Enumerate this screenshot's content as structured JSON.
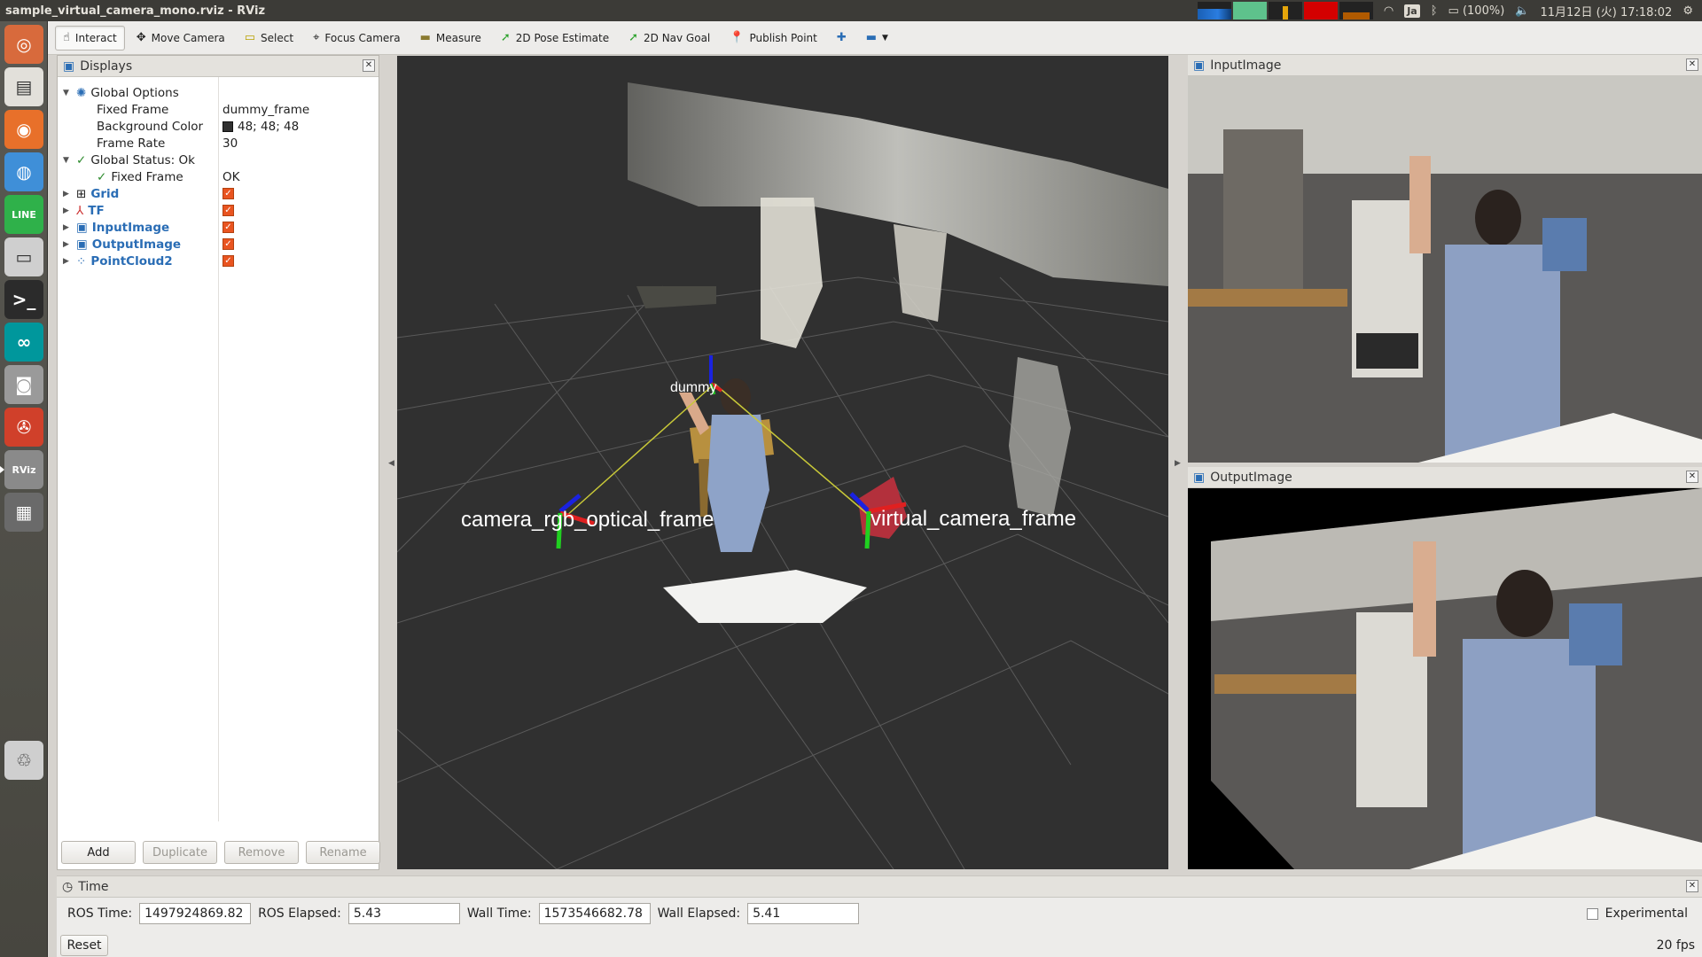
{
  "window": {
    "title": "sample_virtual_camera_mono.rviz - RViz"
  },
  "tray": {
    "lang": "Ja",
    "battery": "(100%)",
    "clock": "11月12日 (火) 17:18:02"
  },
  "launcher": [
    {
      "name": "dash-icon",
      "glyph": "◎"
    },
    {
      "name": "files-icon",
      "glyph": "▤"
    },
    {
      "name": "firefox-icon",
      "glyph": "◉"
    },
    {
      "name": "chrome-icon",
      "glyph": "◍"
    },
    {
      "name": "line-icon",
      "glyph": "LINE"
    },
    {
      "name": "disk-icon",
      "glyph": "▭"
    },
    {
      "name": "terminal-icon",
      "glyph": ">_"
    },
    {
      "name": "arduino-icon",
      "glyph": "∞"
    },
    {
      "name": "camera-icon",
      "glyph": "◙"
    },
    {
      "name": "settings-icon",
      "glyph": "✇"
    },
    {
      "name": "rviz-icon",
      "glyph": "RViz"
    },
    {
      "name": "workspaces-icon",
      "glyph": "▦"
    },
    {
      "name": "trash-icon",
      "glyph": "♲"
    }
  ],
  "toolbar": {
    "interact": "Interact",
    "move_camera": "Move Camera",
    "select": "Select",
    "focus_camera": "Focus Camera",
    "measure": "Measure",
    "pose_estimate": "2D Pose Estimate",
    "nav_goal": "2D Nav Goal",
    "publish_point": "Publish Point"
  },
  "displays": {
    "title": "Displays",
    "global_options": "Global Options",
    "fixed_frame_label": "Fixed Frame",
    "fixed_frame_value": "dummy_frame",
    "bg_color_label": "Background Color",
    "bg_color_value": "48; 48; 48",
    "bg_color_hex": "#303030",
    "frame_rate_label": "Frame Rate",
    "frame_rate_value": "30",
    "global_status": "Global Status: Ok",
    "status_fixed_frame_label": "Fixed Frame",
    "status_fixed_frame_value": "OK",
    "items": [
      "Grid",
      "TF",
      "InputImage",
      "OutputImage",
      "PointCloud2"
    ],
    "buttons": {
      "add": "Add",
      "duplicate": "Duplicate",
      "remove": "Remove",
      "rename": "Rename"
    }
  },
  "view3d": {
    "frame_labels": {
      "camera": "camera_rgb_optical_frame",
      "virtual": "virtual_camera_frame",
      "dummy": "dummy"
    }
  },
  "panels": {
    "input": "InputImage",
    "output": "OutputImage"
  },
  "time": {
    "title": "Time",
    "ros_time_label": "ROS Time:",
    "ros_time": "1497924869.82",
    "ros_elapsed_label": "ROS Elapsed:",
    "ros_elapsed": "5.43",
    "wall_time_label": "Wall Time:",
    "wall_time": "1573546682.78",
    "wall_elapsed_label": "Wall Elapsed:",
    "wall_elapsed": "5.41",
    "experimental": "Experimental",
    "reset": "Reset",
    "fps": "20 fps"
  }
}
